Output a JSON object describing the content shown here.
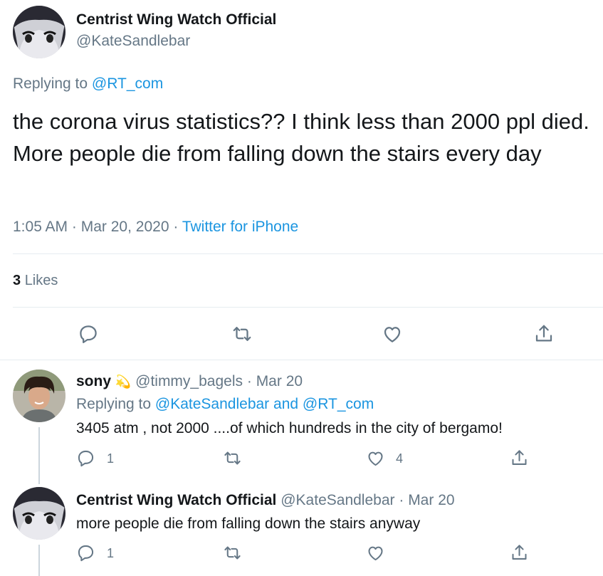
{
  "main_tweet": {
    "display_name": "Centrist Wing Watch Official",
    "handle": "@KateSandlebar",
    "replying_prefix": "Replying to",
    "replying_to": "@RT_com",
    "text": "the corona virus statistics?? I think less than 2000 ppl died. More people die from falling down the stairs every day",
    "time": "1:05 AM",
    "sep1": "·",
    "date": "Mar 20, 2020",
    "sep2": "·",
    "source": "Twitter for iPhone",
    "likes_count": "3",
    "likes_label": "Likes"
  },
  "replies": [
    {
      "display_name": "sony",
      "emoji": "💫",
      "handle": "@timmy_bagels",
      "sep": "·",
      "date": "Mar 20",
      "replying_prefix": "Replying to",
      "replying_to_1": "@KateSandlebar",
      "replying_and": "and",
      "replying_to_2": "@RT_com",
      "text": "3405 atm , not 2000 ....of which hundreds in the city of bergamo!",
      "reply_count": "1",
      "retweet_count": "",
      "like_count": "4"
    },
    {
      "display_name": "Centrist Wing Watch Official",
      "handle": "@KateSandlebar",
      "sep": "·",
      "date": "Mar 20",
      "text": "more people die from falling down the stairs anyway",
      "reply_count": "1",
      "retweet_count": "",
      "like_count": ""
    }
  ],
  "icons": {
    "reply": "reply-icon",
    "retweet": "retweet-icon",
    "like": "heart-icon",
    "share": "share-icon"
  },
  "colors": {
    "link": "#1b95e0",
    "muted": "#657786",
    "divider": "#e6ecf0",
    "thread_line": "#ccd6dd"
  }
}
